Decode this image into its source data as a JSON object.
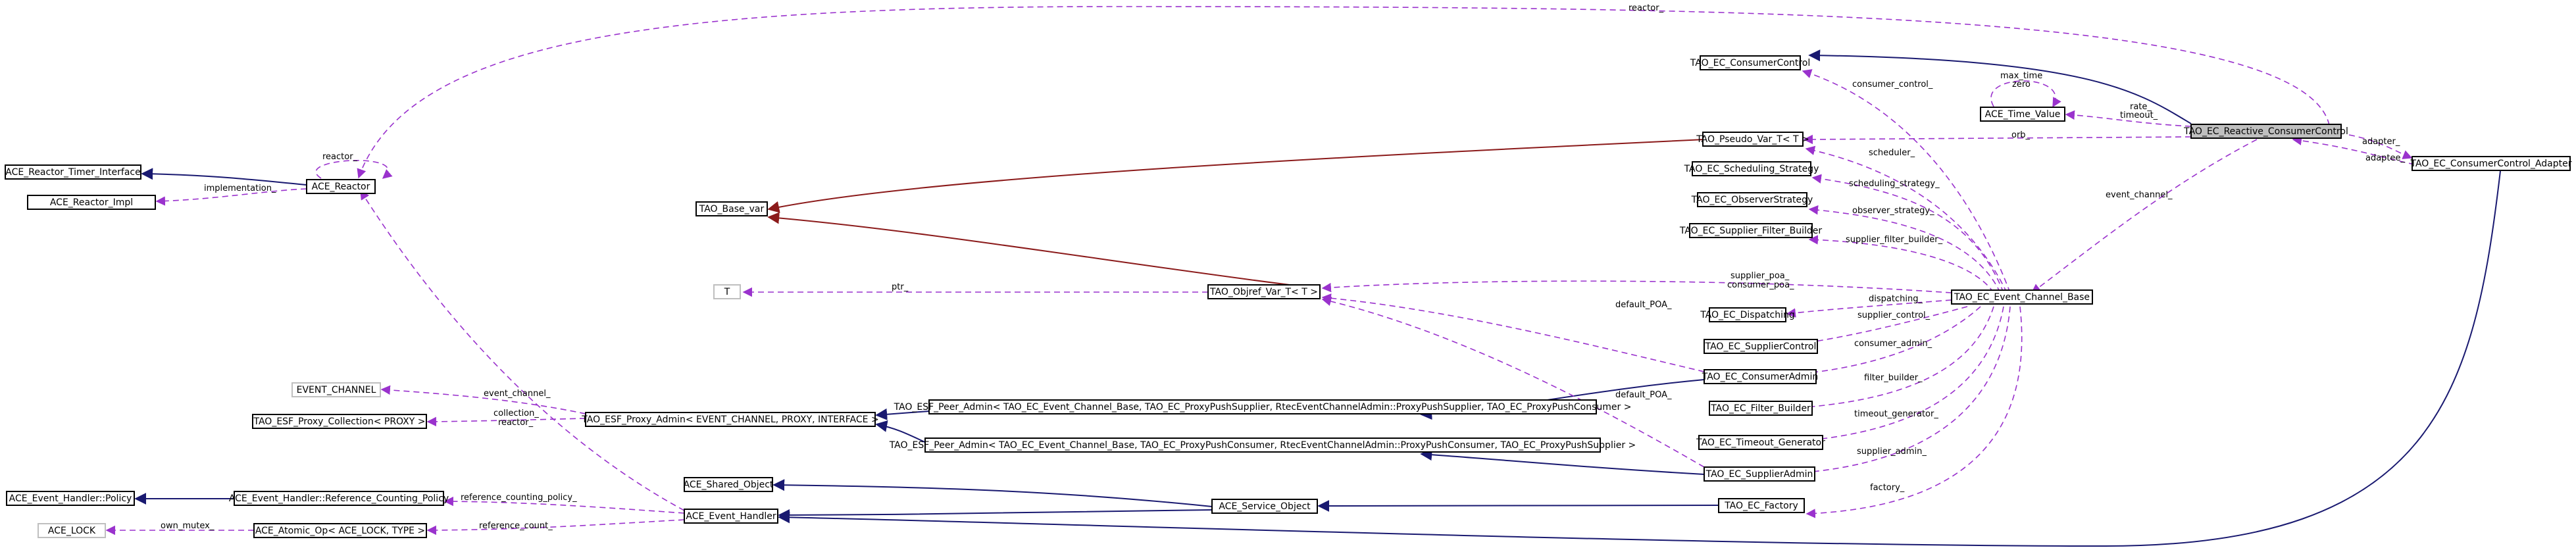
{
  "nodes": {
    "reactive_consumer_control": "TAO_EC_Reactive_ConsumerControl",
    "consumer_control": "TAO_EC_ConsumerControl",
    "time_value": "ACE_Time_Value",
    "pseudo_var": "TAO_Pseudo_Var_T< T >",
    "consumer_control_adapter": "TAO_EC_ConsumerControl_Adapter",
    "scheduling_strategy": "TAO_EC_Scheduling_Strategy",
    "observer_strategy": "TAO_EC_ObserverStrategy",
    "supplier_filter_builder": "TAO_EC_Supplier_Filter_Builder",
    "event_channel_base": "TAO_EC_Event_Channel_Base",
    "objref_var": "TAO_Objref_Var_T< T >",
    "t": "T",
    "base_var": "TAO_Base_var",
    "dispatching": "TAO_EC_Dispatching",
    "supplier_control": "TAO_EC_SupplierControl",
    "consumer_admin": "TAO_EC_ConsumerAdmin",
    "filter_builder": "TAO_EC_Filter_Builder",
    "timeout_generator": "TAO_EC_Timeout_Generator",
    "supplier_admin": "TAO_EC_SupplierAdmin",
    "factory": "TAO_EC_Factory",
    "peer_admin_supplier": "TAO_ESF_Peer_Admin< TAO_EC_Event_Channel_Base, TAO_EC_ProxyPushSupplier, RtecEventChannelAdmin::ProxyPushSupplier, TAO_EC_ProxyPushConsumer >",
    "peer_admin_consumer": "TAO_ESF_Peer_Admin< TAO_EC_Event_Channel_Base, TAO_EC_ProxyPushConsumer, RtecEventChannelAdmin::ProxyPushConsumer, TAO_EC_ProxyPushSupplier >",
    "proxy_admin": "TAO_ESF_Proxy_Admin< EVENT_CHANNEL, PROXY, INTERFACE >",
    "event_channel_tmpl": "EVENT_CHANNEL",
    "proxy_collection": "TAO_ESF_Proxy_Collection< PROXY >",
    "reactor_timer_interface": "ACE_Reactor_Timer_Interface",
    "reactor_impl": "ACE_Reactor_Impl",
    "reactor": "ACE_Reactor",
    "event_handler_policy": "ACE_Event_Handler::Policy",
    "reference_counting_policy": "ACE_Event_Handler::Reference_Counting_Policy",
    "event_handler": "ACE_Event_Handler",
    "shared_object": "ACE_Shared_Object",
    "service_object": "ACE_Service_Object",
    "ace_lock": "ACE_LOCK",
    "atomic_op": "ACE_Atomic_Op< ACE_LOCK, TYPE >"
  },
  "edge_labels": {
    "reactor_top": "reactor_",
    "reactor_self": "reactor_",
    "implementation": "implementation_",
    "consumer_control": "consumer_control_",
    "max_time": "max_time",
    "zero": "zero",
    "rate": "rate_",
    "timeout": "timeout_",
    "orb": "orb_",
    "adapter": "adapter_",
    "adaptee": "adaptee_",
    "scheduler": "scheduler_",
    "scheduling_strategy": "scheduling_strategy_",
    "observer_strategy": "observer_strategy_",
    "supplier_filter_builder": "supplier_filter_builder_",
    "event_channel": "event_channel_",
    "supplier_poa": "supplier_poa_",
    "consumer_poa": "consumer_poa_",
    "dispatching": "dispatching_",
    "ptr": "ptr_",
    "default_poa_1": "default_POA_",
    "supplier_control": "supplier_control_",
    "consumer_admin": "consumer_admin_",
    "filter_builder": "filter_builder_",
    "timeout_generator": "timeout_generator_",
    "default_poa_2": "default_POA_",
    "supplier_admin": "supplier_admin_",
    "factory": "factory_",
    "event_channel_tmpl": "event_channel_",
    "collection": "collection_",
    "reactor_small": "reactor_",
    "reference_counting_policy": "reference_counting_policy_",
    "reference_count": "reference_count_",
    "own_mutex": "own_mutex_"
  },
  "colors": {
    "inheritance_public": "#191970",
    "inheritance_template": "#8b1a1a",
    "usage": "#9a32cd",
    "focus_fill": "#bfbfbf"
  }
}
